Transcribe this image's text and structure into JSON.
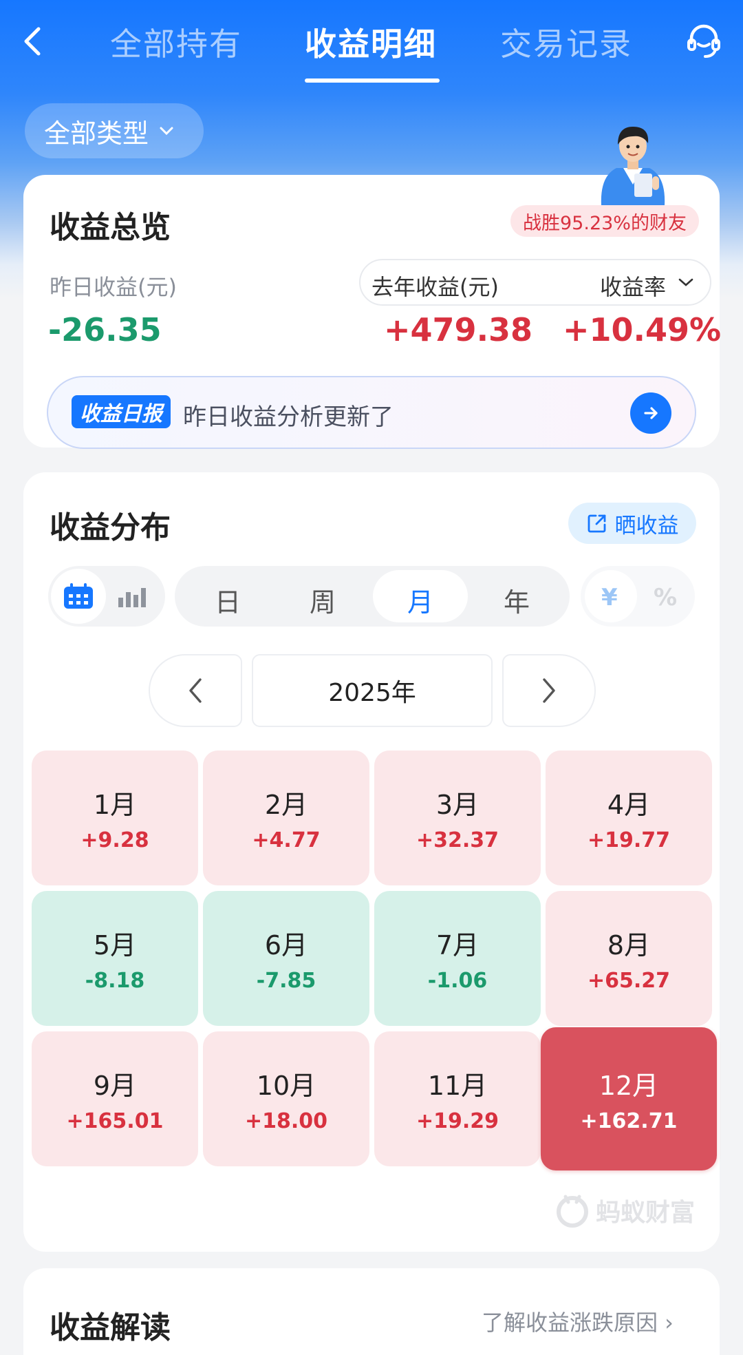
{
  "header": {
    "tabs": [
      {
        "label": "全部持有",
        "active": false
      },
      {
        "label": "收益明细",
        "active": true
      },
      {
        "label": "交易记录",
        "active": false
      }
    ]
  },
  "filter": {
    "type_label": "全部类型"
  },
  "overview": {
    "title": "收益总览",
    "rank_badge": "战胜95.23%的财友",
    "yesterday_label": "昨日收益(元)",
    "yesterday_value": "-26.35",
    "last_year_label": "去年收益(元)",
    "last_year_value": "+479.38",
    "rate_label": "收益率",
    "rate_value": "+10.49%",
    "daily_tag": "收益日报",
    "daily_text": "昨日收益分析更新了"
  },
  "distribution": {
    "title": "收益分布",
    "share_label": "晒收益",
    "periods": [
      "日",
      "周",
      "月",
      "年"
    ],
    "active_period": "月",
    "units": [
      "¥",
      "%"
    ],
    "year_label": "2025年",
    "months": [
      {
        "name": "1月",
        "value": "+9.28",
        "sign": "pos"
      },
      {
        "name": "2月",
        "value": "+4.77",
        "sign": "pos"
      },
      {
        "name": "3月",
        "value": "+32.37",
        "sign": "pos"
      },
      {
        "name": "4月",
        "value": "+19.77",
        "sign": "pos"
      },
      {
        "name": "5月",
        "value": "-8.18",
        "sign": "neg"
      },
      {
        "name": "6月",
        "value": "-7.85",
        "sign": "neg"
      },
      {
        "name": "7月",
        "value": "-1.06",
        "sign": "neg"
      },
      {
        "name": "8月",
        "value": "+65.27",
        "sign": "pos"
      },
      {
        "name": "9月",
        "value": "+165.01",
        "sign": "pos"
      },
      {
        "name": "10月",
        "value": "+18.00",
        "sign": "pos"
      },
      {
        "name": "11月",
        "value": "+19.29",
        "sign": "pos"
      },
      {
        "name": "12月",
        "value": "+162.71",
        "sign": "pos",
        "selected": true
      }
    ],
    "watermark": "蚂蚁财富"
  },
  "interpretation": {
    "title": "收益解读",
    "link": "了解收益涨跌原因 ›"
  },
  "colors": {
    "brand_blue": "#1677ff",
    "gain_red": "#d8313f",
    "loss_green": "#1b9a6c"
  },
  "icons": [
    "back-arrow-icon",
    "customer-service-icon",
    "chevron-down-icon",
    "calendar-icon",
    "bar-chart-icon",
    "share-icon",
    "arrow-right-icon",
    "chevron-left-icon",
    "chevron-right-icon",
    "ant-logo-icon"
  ]
}
